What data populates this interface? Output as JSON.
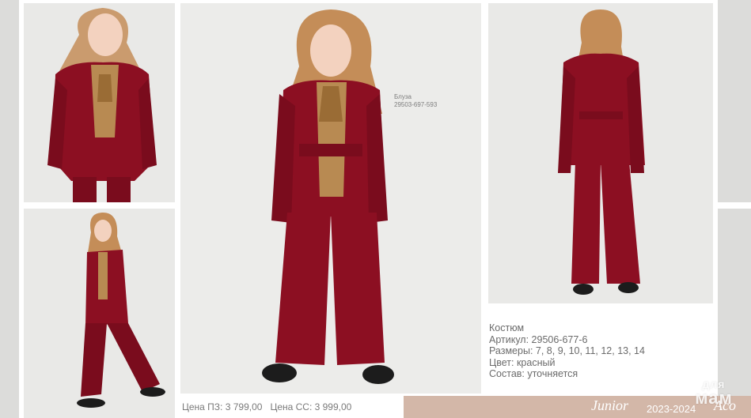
{
  "product": {
    "blouse_label": "Блуза",
    "blouse_sku": "29503-697-593",
    "name": "Костюм",
    "article": "Артикул: 29506-677-6",
    "sizes": "Размеры: 7, 8, 9, 10, 11, 12, 13, 14",
    "color": "Цвет: красный",
    "composition": "Состав: уточняется"
  },
  "prices": {
    "pz": "Цена ПЗ: 3 799,00",
    "cc": "Цена СС: 3 999,00"
  },
  "footer": {
    "brand": "Junior",
    "season": "2023-2024",
    "brand_short": "Acoola"
  },
  "watermark": {
    "line1": "для",
    "line2": "мам"
  },
  "colors": {
    "velvet": "#8c0f22",
    "blouse": "#b88a52",
    "hair": "#c9925a",
    "footer_bar": "#d3b7a8",
    "photo_bg": "#e8e8e6"
  }
}
